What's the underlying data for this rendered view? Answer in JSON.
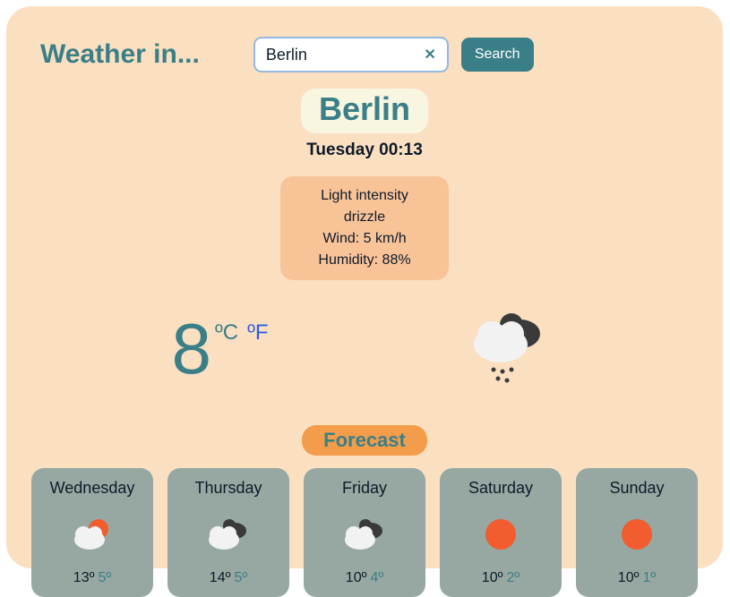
{
  "header": {
    "title": "Weather in...",
    "search_value": "Berlin",
    "search_button": "Search"
  },
  "current": {
    "city": "Berlin",
    "datetime": "Tuesday 00:13",
    "description": "Light intensity drizzle",
    "wind_label": "Wind: 5 km/h",
    "humidity_label": "Humidity: 88%",
    "temperature": "8",
    "unit_c": "ºC",
    "unit_f": "ºF",
    "icon": "rain"
  },
  "forecast_label": "Forecast",
  "forecast": [
    {
      "day": "Wednesday",
      "icon": "partly-cloudy",
      "high": "13º",
      "low": "5º"
    },
    {
      "day": "Thursday",
      "icon": "cloudy",
      "high": "14º",
      "low": "5º"
    },
    {
      "day": "Friday",
      "icon": "cloudy",
      "high": "10º",
      "low": "4º"
    },
    {
      "day": "Saturday",
      "icon": "sunny",
      "high": "10º",
      "low": "2º"
    },
    {
      "day": "Sunday",
      "icon": "sunny",
      "high": "10º",
      "low": "1º"
    }
  ]
}
